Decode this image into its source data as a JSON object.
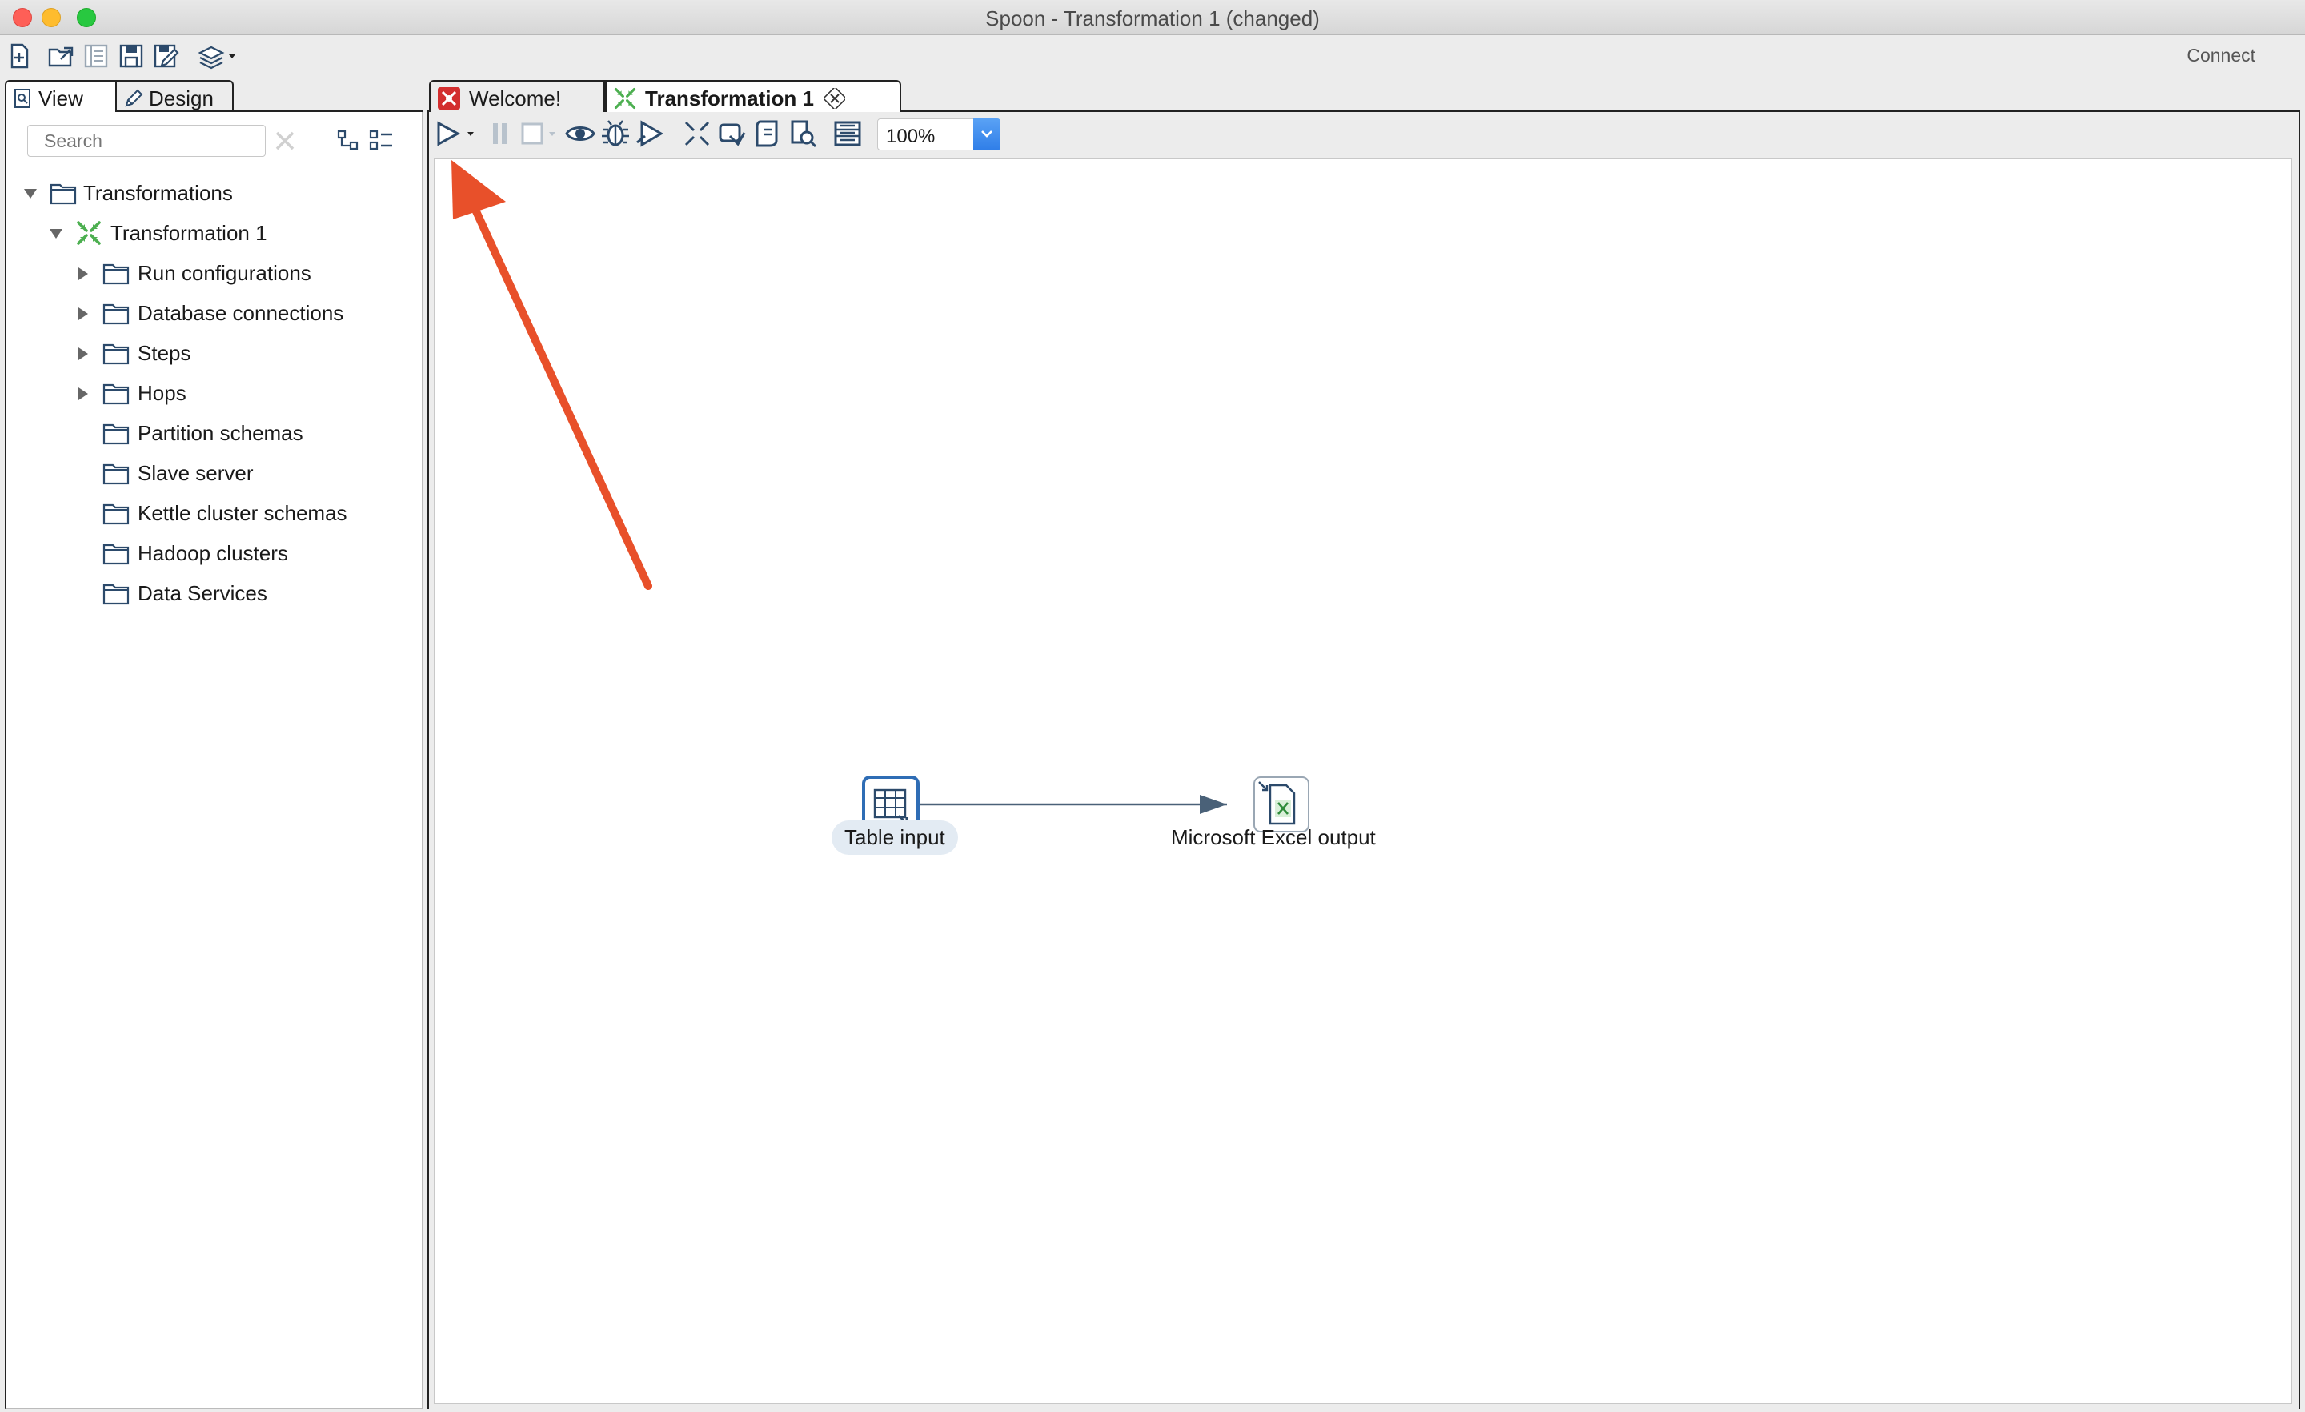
{
  "window": {
    "title": "Spoon - Transformation 1 (changed)"
  },
  "main_toolbar": {
    "connect_label": "Connect"
  },
  "left_panel": {
    "tabs": [
      {
        "label": "View",
        "icon": "view-icon"
      },
      {
        "label": "Design",
        "icon": "pencil-icon"
      }
    ],
    "search_placeholder": "Search",
    "tree": {
      "root": "Transformations",
      "transformation": "Transformation 1",
      "children": [
        {
          "label": "Run configurations",
          "expandable": true
        },
        {
          "label": "Database connections",
          "expandable": true
        },
        {
          "label": "Steps",
          "expandable": true
        },
        {
          "label": "Hops",
          "expandable": true
        },
        {
          "label": "Partition schemas",
          "expandable": false
        },
        {
          "label": "Slave server",
          "expandable": false
        },
        {
          "label": "Kettle cluster schemas",
          "expandable": false
        },
        {
          "label": "Hadoop clusters",
          "expandable": false
        },
        {
          "label": "Data Services",
          "expandable": false
        }
      ]
    }
  },
  "editor": {
    "tabs": [
      {
        "label": "Welcome!",
        "icon": "spoon-icon"
      },
      {
        "label": "Transformation 1",
        "icon": "transformation-icon",
        "active": true
      }
    ],
    "zoom": "100%",
    "steps": [
      {
        "label": "Table input",
        "icon": "table-input-icon",
        "selected": true
      },
      {
        "label": "Microsoft Excel output",
        "icon": "excel-output-icon",
        "selected": false
      }
    ]
  },
  "colors": {
    "annotation_arrow": "#e8502a",
    "step_border_selected": "#2f6db5",
    "hop_line": "#4a6178"
  }
}
